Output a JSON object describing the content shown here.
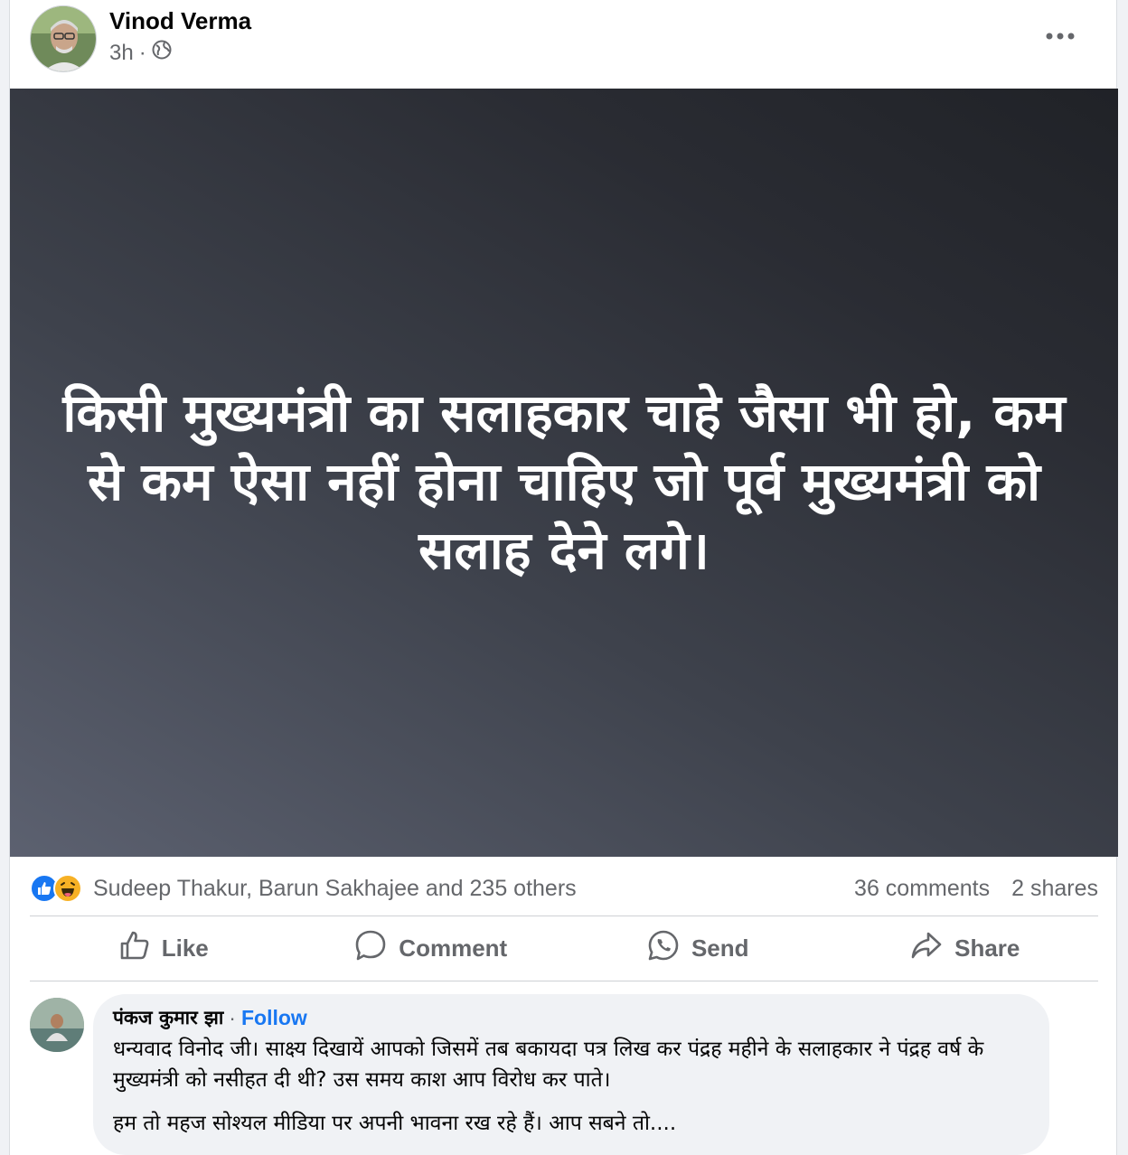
{
  "post": {
    "author": "Vinod Verma",
    "time": "3h",
    "separator": "·",
    "privacy_icon": "globe-icon",
    "text": "किसी मुख्यमंत्री का सलाहकार चाहे जैसा भी हो, कम से कम ऐसा नहीं होना चाहिए जो पूर्व मुख्यमंत्री को सलाह देने लगे।"
  },
  "reactions": {
    "icons": [
      "like-icon",
      "haha-icon"
    ],
    "people": "Sudeep Thakur, Barun Sakhajee and 235 others",
    "comments": "36 comments",
    "shares": "2 shares"
  },
  "actions": {
    "like": "Like",
    "comment": "Comment",
    "send": "Send",
    "share": "Share"
  },
  "comment": {
    "name": "पंकज कुमार झा",
    "separator": "·",
    "follow": "Follow",
    "text1": "धन्यवाद विनोद जी। साक्ष्य दिखायें आपको जिसमें तब बकायदा पत्र लिख कर पंद्रह महीने के सलाहकार ने पंद्रह वर्ष के मुख्यमंत्री को नसीहत दी थी? उस समय काश आप विरोध कर पाते।",
    "text2": "हम तो महज सोश्यल मीडिया पर अपनी भावना रख रहे हैं। आप सबने तो...."
  },
  "colors": {
    "brand_blue": "#1877f2",
    "text_secondary": "#65676b",
    "post_bg_dark": "#202227"
  }
}
